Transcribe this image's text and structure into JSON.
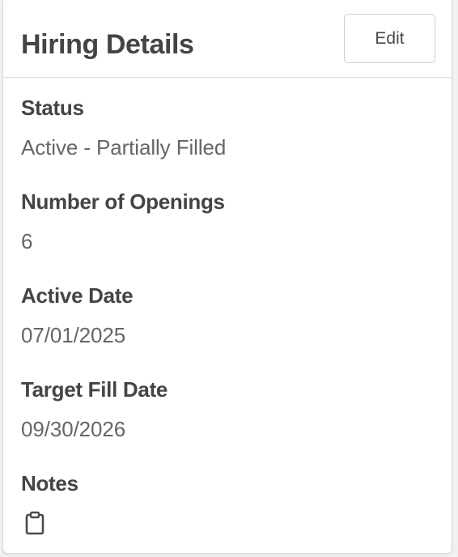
{
  "card": {
    "title": "Hiring Details",
    "edit_label": "Edit"
  },
  "fields": [
    {
      "label": "Status",
      "value": "Active - Partially Filled"
    },
    {
      "label": "Number of Openings",
      "value": "6"
    },
    {
      "label": "Active Date",
      "value": "07/01/2025"
    },
    {
      "label": "Target Fill Date",
      "value": "09/30/2026"
    },
    {
      "label": "Notes",
      "icon": "clipboard-icon"
    }
  ]
}
